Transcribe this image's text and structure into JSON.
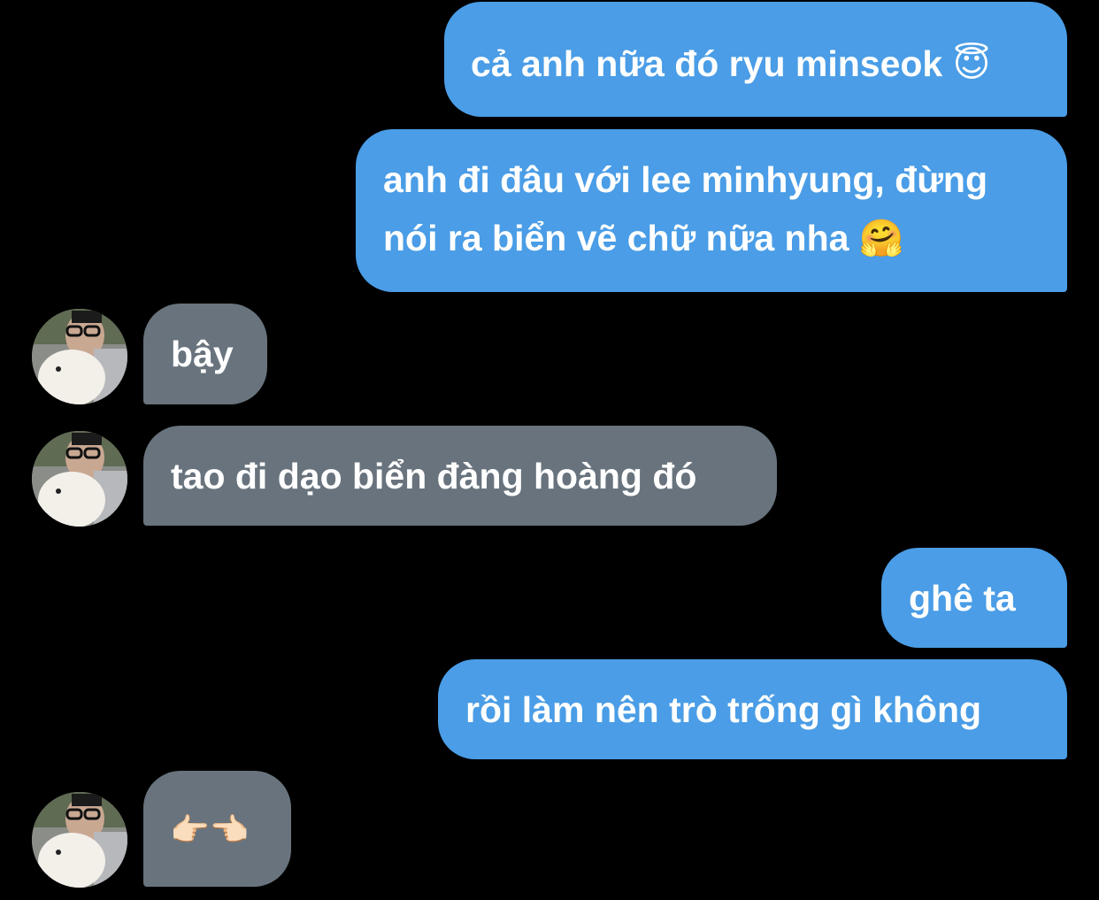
{
  "conversation": {
    "messages": [
      {
        "side": "outgoing",
        "text": "cả anh nữa đó ryu minseok",
        "emoji": "😇"
      },
      {
        "side": "outgoing",
        "text_line1": "anh đi đâu với lee minhyung, đừng",
        "text_line2": "nói ra biển vẽ chữ nữa nha",
        "emoji": "🤗"
      },
      {
        "side": "incoming",
        "text": "bậy",
        "avatar": "contact-avatar"
      },
      {
        "side": "incoming",
        "text": "tao đi dạo biển đàng hoàng đó",
        "avatar": "contact-avatar"
      },
      {
        "side": "outgoing",
        "text": "ghê ta"
      },
      {
        "side": "outgoing",
        "text": "rồi làm nên trò trống gì không"
      },
      {
        "side": "incoming",
        "text": "👉🏻👈🏻",
        "avatar": "contact-avatar"
      }
    ]
  },
  "colors": {
    "background": "#000000",
    "outgoing_bubble": "#4a9de6",
    "incoming_bubble": "#68737d",
    "text": "#ffffff"
  }
}
